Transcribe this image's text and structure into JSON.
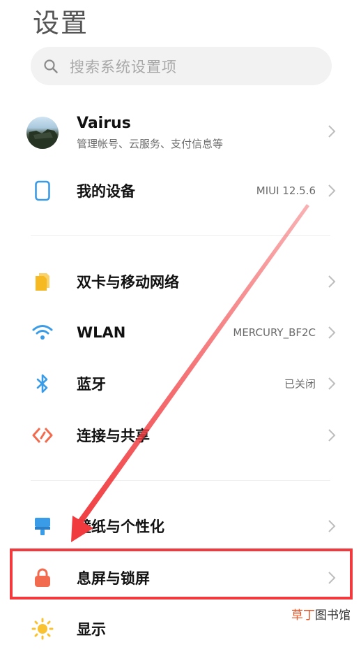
{
  "header": {
    "title": "设置"
  },
  "search": {
    "placeholder": "搜索系统设置项"
  },
  "account": {
    "name": "Vairus",
    "subtitle": "管理帐号、云服务、支付信息等"
  },
  "items": [
    {
      "label": "我的设备",
      "value": "MIUI 12.5.6",
      "icon": "phone-icon"
    },
    {
      "label": "双卡与移动网络",
      "value": "",
      "icon": "sim-card-icon"
    },
    {
      "label": "WLAN",
      "value": "MERCURY_BF2C",
      "icon": "wifi-icon"
    },
    {
      "label": "蓝牙",
      "value": "已关闭",
      "icon": "bluetooth-icon"
    },
    {
      "label": "连接与共享",
      "value": "",
      "icon": "share-connection-icon"
    },
    {
      "label": "壁纸与个性化",
      "value": "",
      "icon": "wallpaper-brush-icon"
    },
    {
      "label": "息屏与锁屏",
      "value": "",
      "icon": "lock-icon"
    },
    {
      "label": "显示",
      "value": "",
      "icon": "sun-icon"
    }
  ],
  "annotation": {
    "highlight_color": "#f03a3e"
  },
  "watermark": {
    "part1": "草丁",
    "part2": "图书馆"
  },
  "colors": {
    "accent_blue": "#3a9be6",
    "sim_yellow": "#f6b921",
    "lock_orange": "#f26b4f",
    "display_yellow": "#f8c230"
  }
}
